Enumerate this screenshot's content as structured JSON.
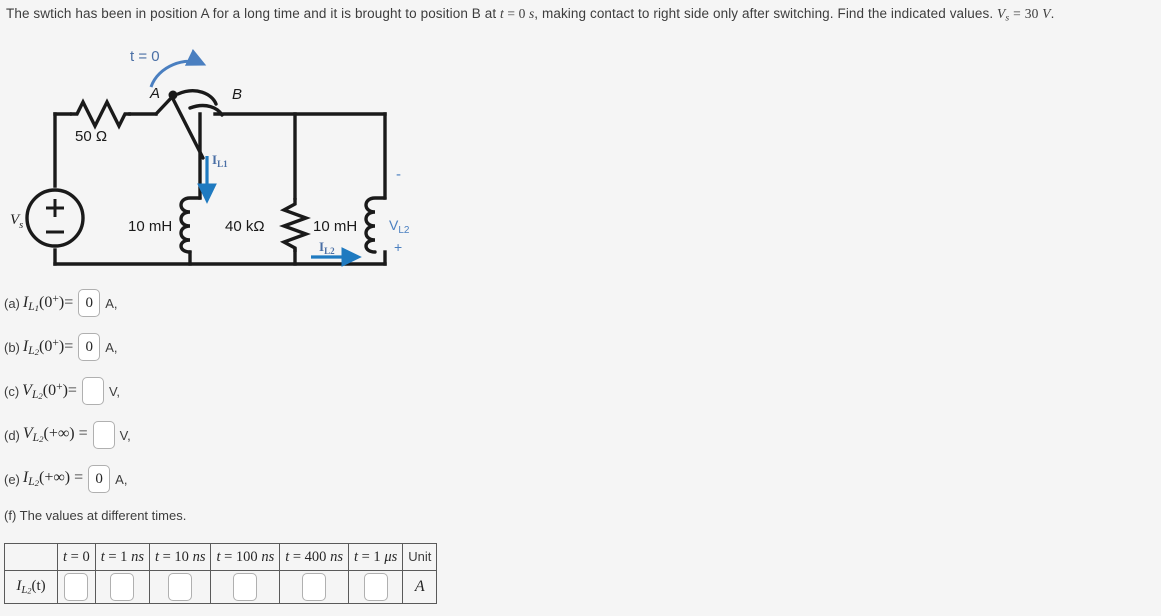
{
  "prompt": {
    "part1": "The swtich has been in position A for a long time and it is brought to position B at",
    "eq_t0": "t = 0 s",
    "part2": ", making contact to right side only after switching. Find the indicated values.",
    "vs_value": "V",
    "vs_sub": "s",
    "vs_eq": "= 30 V."
  },
  "circuit": {
    "switch_time_label": "t = 0",
    "terminal_a": "A",
    "terminal_b": "B",
    "source_label": "V",
    "source_sub": "s",
    "source_plus": "+",
    "source_minus": "−",
    "resistor_series": "50 Ω",
    "inductor_1": "10 mH",
    "resistor_shunt": "40 kΩ",
    "inductor_2": "10 mH",
    "current_l1": "I",
    "current_l1_sub": "L1",
    "current_l2": "I",
    "current_l2_sub": "L2",
    "voltage_l2": "V",
    "voltage_l2_sub": "L2",
    "voltage_l2_minus": "-",
    "voltage_l2_plus": "+",
    "accent_color": "#1f7ac0",
    "label_blue": "#4a6fa5"
  },
  "answers": [
    {
      "tag": "(a)",
      "sym": "I",
      "sub": "L",
      "subsub": "1",
      "arg": "(0",
      "sup": "+",
      "argend": ")",
      "eq": "=",
      "value": "0",
      "unit": "A,"
    },
    {
      "tag": "(b)",
      "sym": "I",
      "sub": "L",
      "subsub": "2",
      "arg": "(0",
      "sup": "+",
      "argend": ")",
      "eq": "=",
      "value": "0",
      "unit": "A,"
    },
    {
      "tag": "(c)",
      "sym": "V",
      "sub": "L",
      "subsub": "2",
      "arg": "(0",
      "sup": "+",
      "argend": ")",
      "eq": "=",
      "value": "",
      "unit": "V,"
    },
    {
      "tag": "(d)",
      "sym": "V",
      "sub": "L",
      "subsub": "2",
      "arg": "(+∞)",
      "sup": "",
      "argend": "",
      "eq": "=",
      "value": "",
      "unit": "V,"
    },
    {
      "tag": "(e)",
      "sym": "I",
      "sub": "L",
      "subsub": "2",
      "arg": "(+∞)",
      "sup": "",
      "argend": "",
      "eq": "=",
      "value": "0",
      "unit": "A,"
    }
  ],
  "part_f": {
    "label": "(f) The values at different times."
  },
  "table": {
    "corner": "",
    "headers": [
      "t = 0",
      "t = 1 ns",
      "t = 10 ns",
      "t = 100 ns",
      "t = 400 ns",
      "t = 1 μs"
    ],
    "unit_header": "Unit",
    "row_label_sym": "I",
    "row_label_sub": "L",
    "row_label_subsub": "2",
    "row_label_arg": "(t)",
    "cells": [
      "",
      "",
      "",
      "",
      "",
      ""
    ],
    "row_unit": "A"
  }
}
